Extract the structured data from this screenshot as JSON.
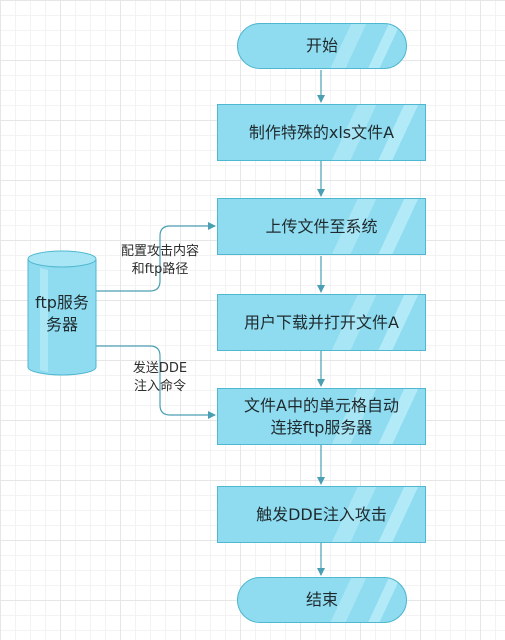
{
  "flow": {
    "start": "开始",
    "steps": [
      "制作特殊的xls文件A",
      "上传文件至系统",
      "用户下载并打开文件A",
      [
        "文件A中的单元格自动",
        "连接ftp服务器"
      ],
      "触发DDE注入攻击"
    ],
    "end": "结束"
  },
  "server": {
    "label": [
      "ftp服务",
      "务器"
    ]
  },
  "edge_labels": {
    "config": [
      "配置攻击内容",
      "和ftp路径"
    ],
    "send_dde": [
      "发送DDE",
      "注入命令"
    ]
  },
  "colors": {
    "node_fill": "#8fdcf0",
    "node_border": "#4fb7cf",
    "connector": "#4a9fb2"
  }
}
